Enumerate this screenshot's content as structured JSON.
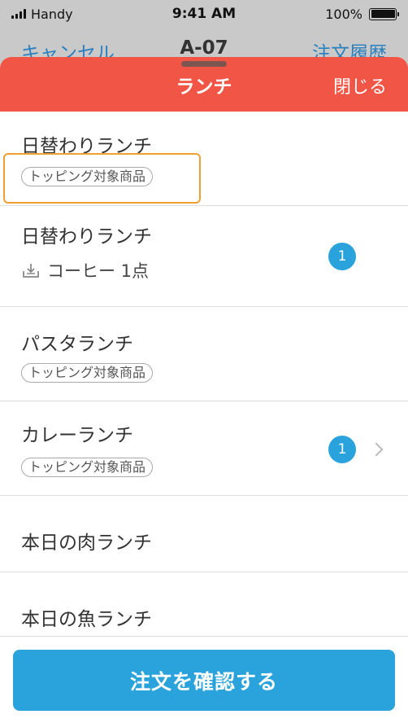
{
  "status_bar": {
    "carrier": "Handy",
    "time": "9:41 AM",
    "battery": "100%",
    "battery_level": 1.0,
    "icons": [
      "signal-icon",
      "battery-icon"
    ]
  },
  "behind_header": {
    "left": "キャンセル",
    "title": "A-07",
    "right": "注文履歴"
  },
  "sheet": {
    "title": "ランチ",
    "close_label": "閉じる"
  },
  "colors": {
    "header_red": "#f05545",
    "accent_blue": "#2aa3dc",
    "highlight_orange": "#f0a030"
  },
  "menu": {
    "items": [
      {
        "name": "日替わりランチ",
        "tag": "トッピング対象商品"
      },
      {
        "name": "日替わりランチ",
        "option": "コーヒー 1点",
        "option_icon": "topping-icon",
        "count": "1"
      },
      {
        "name": "パスタランチ",
        "tag": "トッピング対象商品"
      },
      {
        "name": "カレーランチ",
        "tag": "トッピング対象商品",
        "count": "1",
        "has_chevron": true
      },
      {
        "name": "本日の肉ランチ"
      },
      {
        "name": "本日の魚ランチ"
      }
    ]
  },
  "footer": {
    "confirm_label": "注文を確認する"
  }
}
